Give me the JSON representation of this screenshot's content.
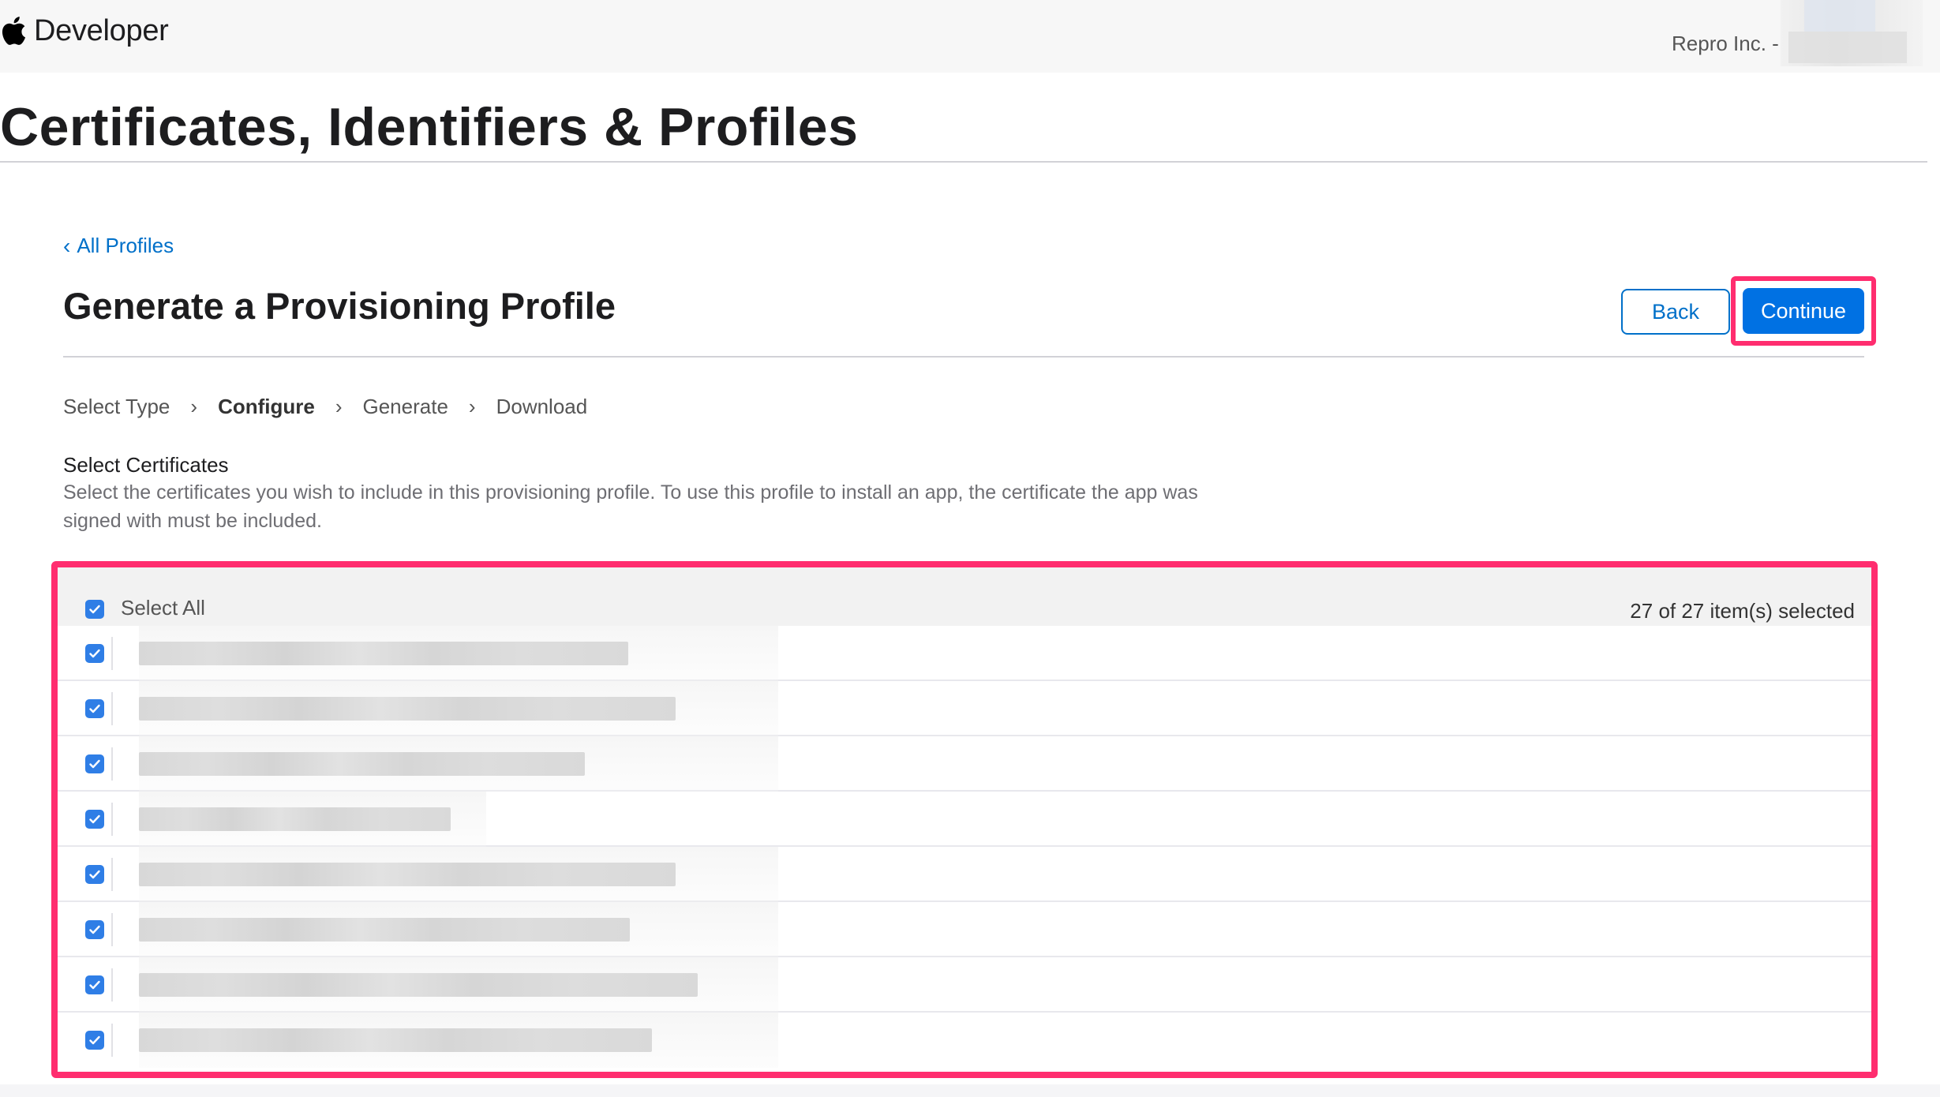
{
  "header": {
    "brand": "Developer",
    "account": "Repro Inc. -"
  },
  "page_title": "Certificates, Identifiers & Profiles",
  "breadcrumb": {
    "back_label": "All Profiles"
  },
  "section_title": "Generate a Provisioning Profile",
  "actions": {
    "back_label": "Back",
    "continue_label": "Continue"
  },
  "steps": [
    {
      "label": "Select Type",
      "active": false
    },
    {
      "label": "Configure",
      "active": true
    },
    {
      "label": "Generate",
      "active": false
    },
    {
      "label": "Download",
      "active": false
    }
  ],
  "certificates": {
    "heading": "Select Certificates",
    "description": "Select the certificates you wish to include in this provisioning profile. To use this profile to install an app, the certificate the app was signed with must be included.",
    "select_all_label": "Select All",
    "selected_count": "27 of 27 item(s) selected",
    "rows": [
      {
        "checked": true
      },
      {
        "checked": true
      },
      {
        "checked": true
      },
      {
        "checked": true
      },
      {
        "checked": true
      },
      {
        "checked": true
      },
      {
        "checked": true
      },
      {
        "checked": true
      }
    ]
  },
  "colors": {
    "accent": "#0071e3",
    "link": "#0070c9",
    "highlight": "#ff2d6f",
    "checkbox": "#2f7ee6"
  }
}
